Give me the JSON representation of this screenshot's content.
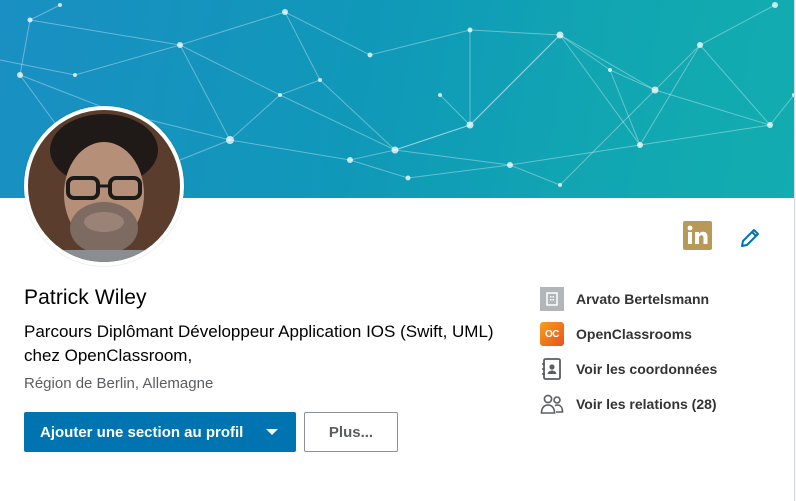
{
  "profile": {
    "name": "Patrick Wiley",
    "headline": "Parcours Diplômant Développeur Application IOS (Swift, UML) chez OpenClassroom,",
    "location": "Région de Berlin, Allemagne"
  },
  "actions": {
    "primary_label": "Ajouter une section au profil",
    "secondary_label": "Plus..."
  },
  "sidebar": {
    "items": [
      {
        "label": "Arvato Bertelsmann",
        "icon": "building-icon"
      },
      {
        "label": "OpenClassrooms",
        "icon": "openclassrooms-logo",
        "logo_text": "OC"
      },
      {
        "label": "Voir les coordonnées",
        "icon": "contact-card-icon"
      },
      {
        "label": "Voir les relations (28)",
        "icon": "people-icon"
      }
    ]
  },
  "colors": {
    "primary": "#0073b1",
    "banner_start": "#1a8fc3",
    "banner_end": "#12adb0",
    "linkedin_badge": "#b79a57",
    "edit_icon": "#0073b1"
  }
}
